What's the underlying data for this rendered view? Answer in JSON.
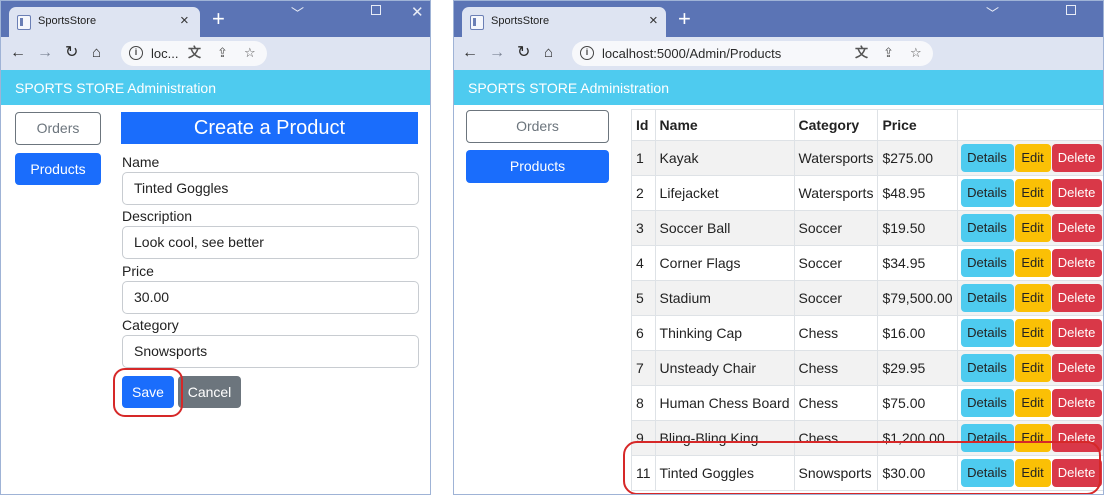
{
  "left_window": {
    "tab_title": "SportsStore",
    "url": "loc...",
    "header_title": "SPORTS STORE Administration",
    "nav": {
      "orders": "Orders",
      "products": "Products"
    },
    "form": {
      "title": "Create a Product",
      "fields": [
        {
          "label": "Name",
          "value": "Tinted Goggles"
        },
        {
          "label": "Description",
          "value": "Look cool, see better"
        },
        {
          "label": "Price",
          "value": "30.00"
        },
        {
          "label": "Category",
          "value": "Snowsports"
        }
      ],
      "save_label": "Save",
      "cancel_label": "Cancel"
    }
  },
  "right_window": {
    "tab_title": "SportsStore",
    "url": "localhost:5000/Admin/Products",
    "header_title": "SPORTS STORE Administration",
    "nav": {
      "orders": "Orders",
      "products": "Products"
    },
    "table": {
      "columns": [
        "Id",
        "Name",
        "Category",
        "Price",
        ""
      ],
      "rows": [
        {
          "id": "1",
          "name": "Kayak",
          "category": "Watersports",
          "price": "$275.00"
        },
        {
          "id": "2",
          "name": "Lifejacket",
          "category": "Watersports",
          "price": "$48.95"
        },
        {
          "id": "3",
          "name": "Soccer Ball",
          "category": "Soccer",
          "price": "$19.50"
        },
        {
          "id": "4",
          "name": "Corner Flags",
          "category": "Soccer",
          "price": "$34.95"
        },
        {
          "id": "5",
          "name": "Stadium",
          "category": "Soccer",
          "price": "$79,500.00"
        },
        {
          "id": "6",
          "name": "Thinking Cap",
          "category": "Chess",
          "price": "$16.00"
        },
        {
          "id": "7",
          "name": "Unsteady Chair",
          "category": "Chess",
          "price": "$29.95"
        },
        {
          "id": "8",
          "name": "Human Chess Board",
          "category": "Chess",
          "price": "$75.00"
        },
        {
          "id": "9",
          "name": "Bling-Bling King",
          "category": "Chess",
          "price": "$1,200.00"
        },
        {
          "id": "11",
          "name": "Tinted Goggles",
          "category": "Snowsports",
          "price": "$30.00"
        }
      ],
      "actions": {
        "details": "Details",
        "edit": "Edit",
        "delete": "Delete"
      }
    }
  },
  "colors": {
    "titlebar": "#5b74b5",
    "header": "#4ecbef",
    "primary": "#1a6dfc",
    "details": "#4ecbef",
    "edit": "#fbc005",
    "delete": "#d93848",
    "highlight": "#d62828"
  },
  "icons": [
    "page-icon",
    "close-icon",
    "plus-icon",
    "minimize-icon",
    "maximize-icon",
    "close-window-icon",
    "back-arrow-icon",
    "forward-arrow-icon",
    "reload-icon",
    "home-icon",
    "info-icon",
    "translate-icon",
    "share-icon",
    "star-icon"
  ]
}
